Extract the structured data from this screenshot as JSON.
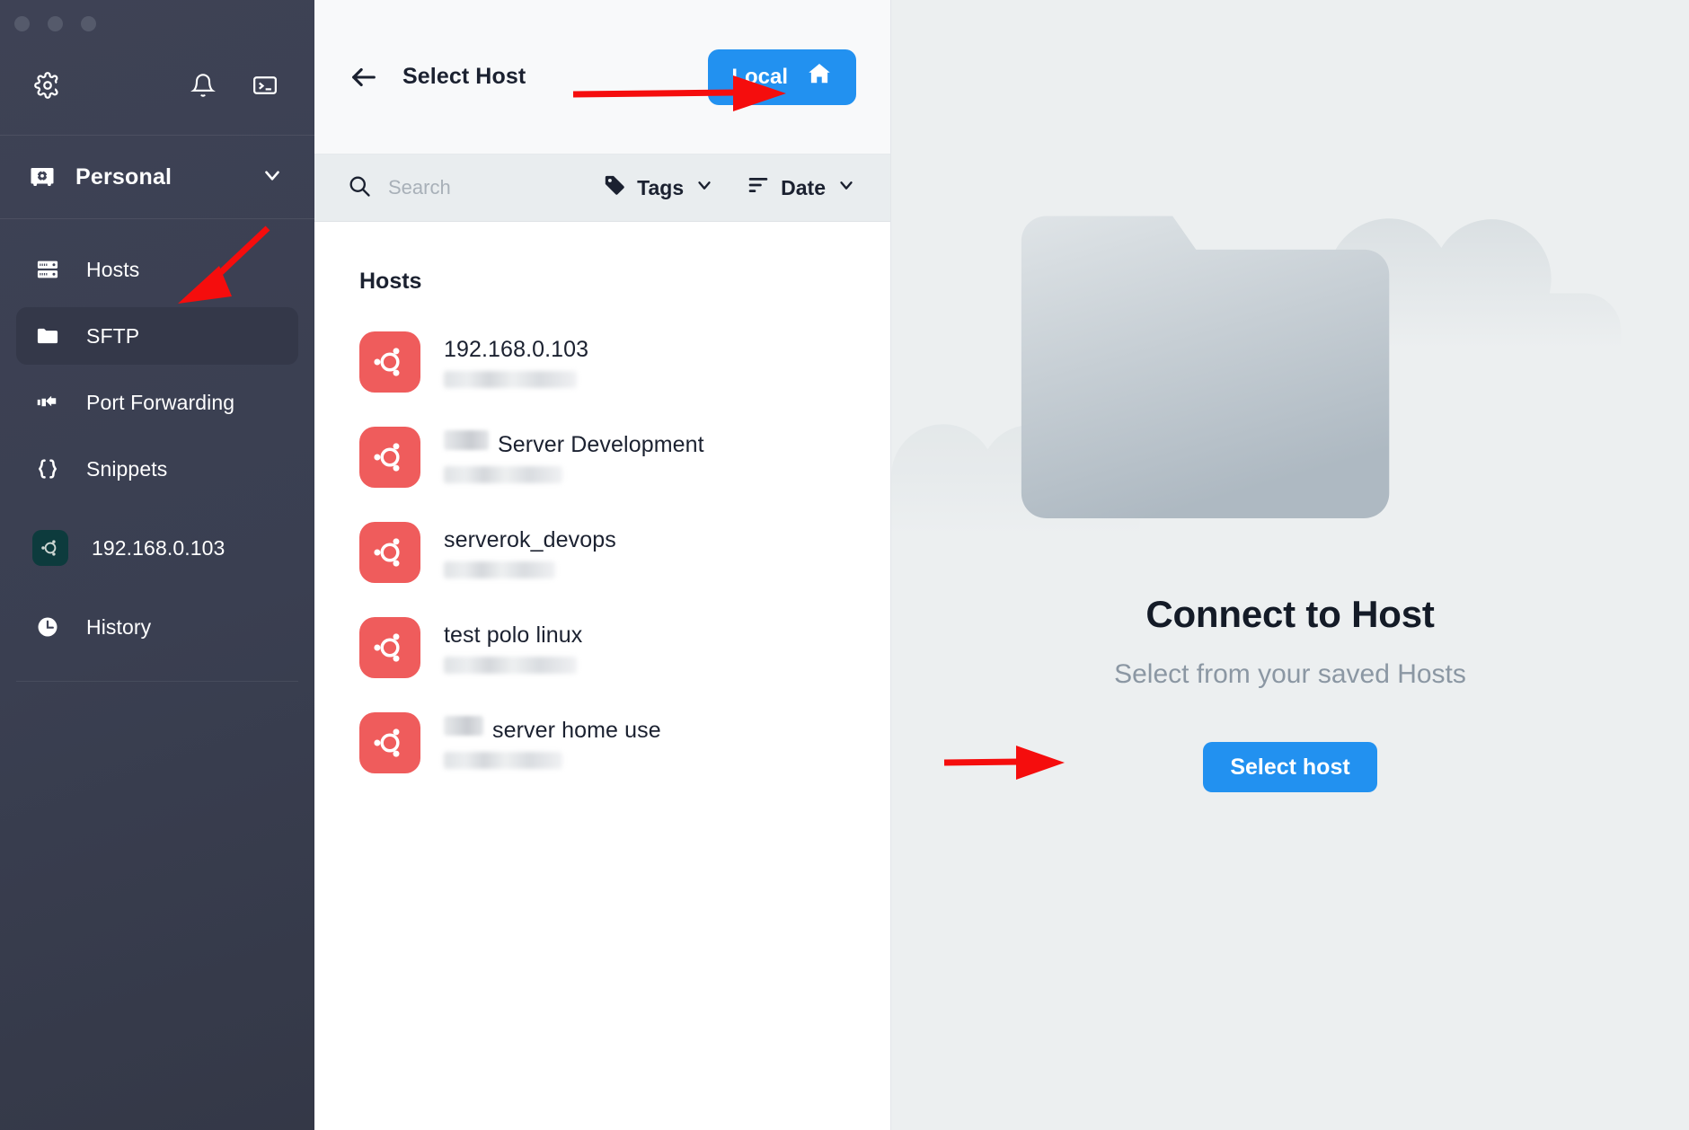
{
  "window": {
    "traffic_lights": [
      "close",
      "minimize",
      "maximize"
    ]
  },
  "sidebar": {
    "toolbar": {
      "settings_icon": "gear-icon",
      "notifications_icon": "bell-icon",
      "terminal_icon": "terminal-icon"
    },
    "vault": {
      "icon": "vault-icon",
      "name": "Personal",
      "chevron": "chevron-down-icon"
    },
    "items": [
      {
        "label": "Hosts",
        "icon": "server-icon",
        "active": false
      },
      {
        "label": "SFTP",
        "icon": "folder-icon",
        "active": true
      },
      {
        "label": "Port Forwarding",
        "icon": "port-forward-icon",
        "active": false
      },
      {
        "label": "Snippets",
        "icon": "braces-icon",
        "active": false
      },
      {
        "label": "192.168.0.103",
        "icon": "ubuntu-icon",
        "active": false
      },
      {
        "label": "History",
        "icon": "clock-icon",
        "active": false
      }
    ]
  },
  "middle": {
    "header": {
      "back_icon": "arrow-left-icon",
      "title": "Select Host",
      "local_button": {
        "label": "Local",
        "icon": "home-icon",
        "color": "#2291f0"
      }
    },
    "filter_bar": {
      "search_icon": "search-icon",
      "search_value": "",
      "search_placeholder": "Search",
      "tags": {
        "label": "Tags",
        "icon": "tag-icon",
        "chevron": "chevron-down-icon"
      },
      "date": {
        "label": "Date",
        "icon": "sort-icon",
        "chevron": "chevron-down-icon"
      }
    },
    "list": {
      "section_title": "Hosts",
      "hosts": [
        {
          "name": "192.168.0.103",
          "prefix_redacted": false,
          "prefix_width": 0,
          "subtitle_redacted": true,
          "subtitle_width": 148,
          "icon": "ubuntu-icon",
          "icon_color": "#ef5c5c"
        },
        {
          "name": "Server Development",
          "prefix_redacted": true,
          "prefix_width": 50,
          "subtitle_redacted": true,
          "subtitle_width": 132,
          "icon": "ubuntu-icon",
          "icon_color": "#ef5c5c"
        },
        {
          "name": "serverok_devops",
          "prefix_redacted": false,
          "prefix_width": 0,
          "subtitle_redacted": true,
          "subtitle_width": 124,
          "icon": "ubuntu-icon",
          "icon_color": "#ef5c5c"
        },
        {
          "name": "test polo linux",
          "prefix_redacted": false,
          "prefix_width": 0,
          "subtitle_redacted": true,
          "subtitle_width": 148,
          "icon": "ubuntu-icon",
          "icon_color": "#ef5c5c"
        },
        {
          "name": "server home use",
          "prefix_redacted": true,
          "prefix_width": 44,
          "subtitle_redacted": true,
          "subtitle_width": 132,
          "icon": "ubuntu-icon",
          "icon_color": "#ef5c5c"
        }
      ]
    }
  },
  "right": {
    "illustration": "folder-with-clouds-illustration",
    "title": "Connect to Host",
    "subtitle": "Select from your saved Hosts",
    "button_label": "Select host",
    "button_color": "#2291f0"
  },
  "annotations": {
    "color": "#f50d0d",
    "arrows": [
      {
        "name": "arrow-to-local-button",
        "target": "Local button"
      },
      {
        "name": "arrow-to-sftp-item",
        "target": "SFTP sidebar item"
      },
      {
        "name": "arrow-to-select-host-button",
        "target": "Select host button"
      }
    ]
  }
}
